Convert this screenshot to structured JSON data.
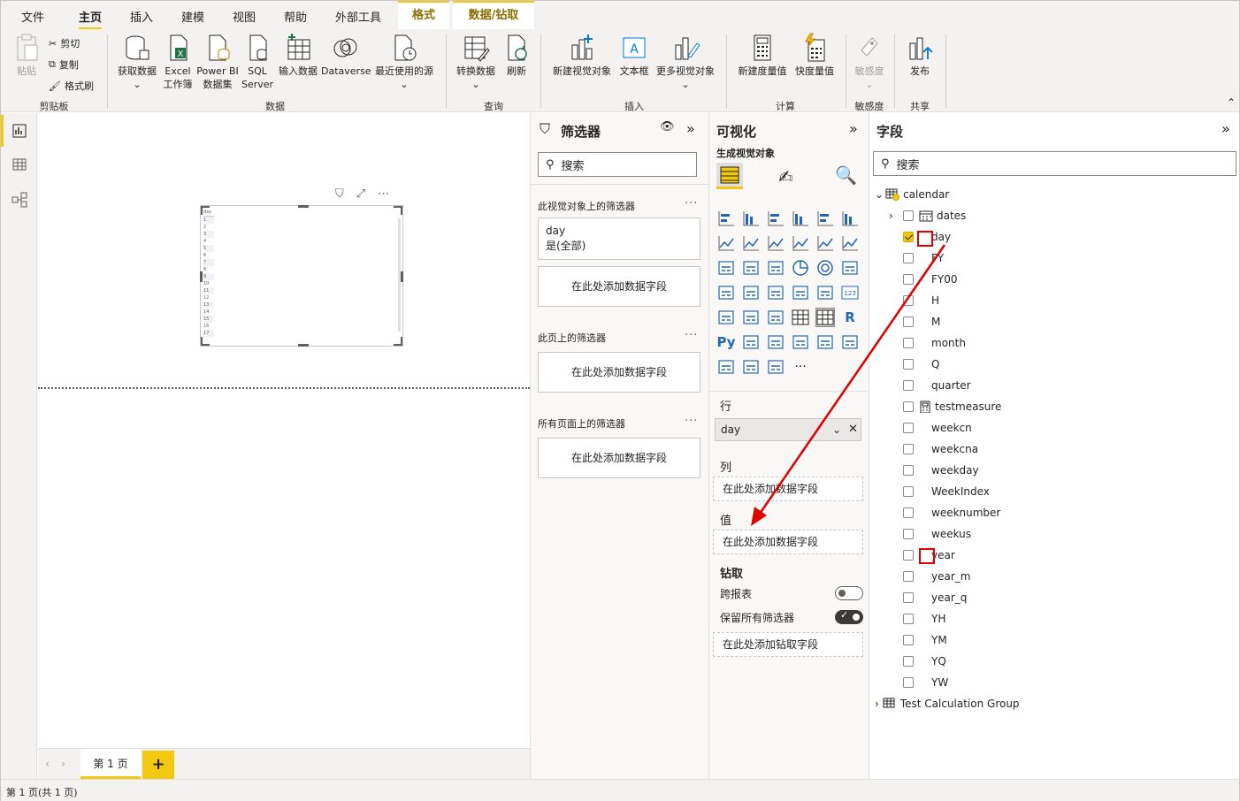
{
  "tabs": [
    "文件",
    "主页",
    "插入",
    "建模",
    "视图",
    "帮助",
    "外部工具",
    "格式",
    "数据/钻取"
  ],
  "ribbon": {
    "clipboard": {
      "paste": "粘贴",
      "cut": "剪切",
      "copy": "复制",
      "format_painter": "格式刷",
      "group": "剪贴板"
    },
    "data": {
      "get_data": "获取数据",
      "excel_1": "Excel",
      "excel_2": "工作簿",
      "pbi_1": "Power BI",
      "pbi_2": "数据集",
      "sql_1": "SQL",
      "sql_2": "Server",
      "enter_data": "输入数据",
      "dataverse": "Dataverse",
      "recent": "最近使用的源",
      "group": "数据"
    },
    "query": {
      "transform": "转换数据",
      "refresh": "刷新",
      "group": "查询"
    },
    "insert": {
      "new_visual": "新建视觉对象",
      "textbox": "文本框",
      "more_visuals": "更多视觉对象",
      "group": "插入"
    },
    "calc": {
      "new_measure": "新建度量值",
      "quick_measure": "快度量值",
      "group": "计算"
    },
    "sensitivity": {
      "label": "敏感度",
      "group": "敏感度"
    },
    "share": {
      "publish": "发布",
      "group": "共享"
    }
  },
  "canvas": {
    "table_header": "day",
    "table_rows": [
      "1",
      "2",
      "3",
      "4",
      "5",
      "6",
      "7",
      "8",
      "9",
      "10",
      "11",
      "12",
      "13",
      "14",
      "15",
      "16",
      "17"
    ]
  },
  "pages": {
    "tab": "第 1 页",
    "add": "+"
  },
  "status": "第 1 页(共 1 页)",
  "filters": {
    "title": "筛选器",
    "search": "搜索",
    "visual_section": "此视觉对象上的筛选器",
    "filter_field": "day",
    "filter_value": "是(全部)",
    "add_field": "在此处添加数据字段",
    "page_section": "此页上的筛选器",
    "all_section": "所有页面上的筛选器"
  },
  "viz": {
    "title": "可视化",
    "subtitle": "生成视觉对象",
    "rows_label": "行",
    "rows_value": "day",
    "columns_label": "列",
    "add_field": "在此处添加数据字段",
    "values_label": "值",
    "drill_label": "钻取",
    "cross_report": "跨报表",
    "cross_report_on": false,
    "keep_filters": "保留所有筛选器",
    "keep_filters_on": true,
    "drill_add": "在此处添加钻取字段"
  },
  "fields": {
    "title": "字段",
    "search": "搜索",
    "table": "calendar",
    "items": [
      {
        "name": "dates",
        "checked": false,
        "icon": "calendar-hierarchy-icon",
        "expand": true
      },
      {
        "name": "day",
        "checked": true
      },
      {
        "name": "FY",
        "checked": false
      },
      {
        "name": "FY00",
        "checked": false
      },
      {
        "name": "H",
        "checked": false
      },
      {
        "name": "M",
        "checked": false
      },
      {
        "name": "month",
        "checked": false
      },
      {
        "name": "Q",
        "checked": false
      },
      {
        "name": "quarter",
        "checked": false
      },
      {
        "name": "testmeasure",
        "checked": false,
        "icon": "calculator-icon"
      },
      {
        "name": "weekcn",
        "checked": false
      },
      {
        "name": "weekcna",
        "checked": false
      },
      {
        "name": "weekday",
        "checked": false
      },
      {
        "name": "WeekIndex",
        "checked": false
      },
      {
        "name": "weeknumber",
        "checked": false
      },
      {
        "name": "weekus",
        "checked": false
      },
      {
        "name": "year",
        "checked": false
      },
      {
        "name": "year_m",
        "checked": false
      },
      {
        "name": "year_q",
        "checked": false
      },
      {
        "name": "YH",
        "checked": false
      },
      {
        "name": "YM",
        "checked": false
      },
      {
        "name": "YQ",
        "checked": false
      },
      {
        "name": "YW",
        "checked": false
      }
    ],
    "table2": "Test Calculation Group"
  },
  "colors": {
    "accent": "#f2c811",
    "annotation": "#e00000"
  }
}
